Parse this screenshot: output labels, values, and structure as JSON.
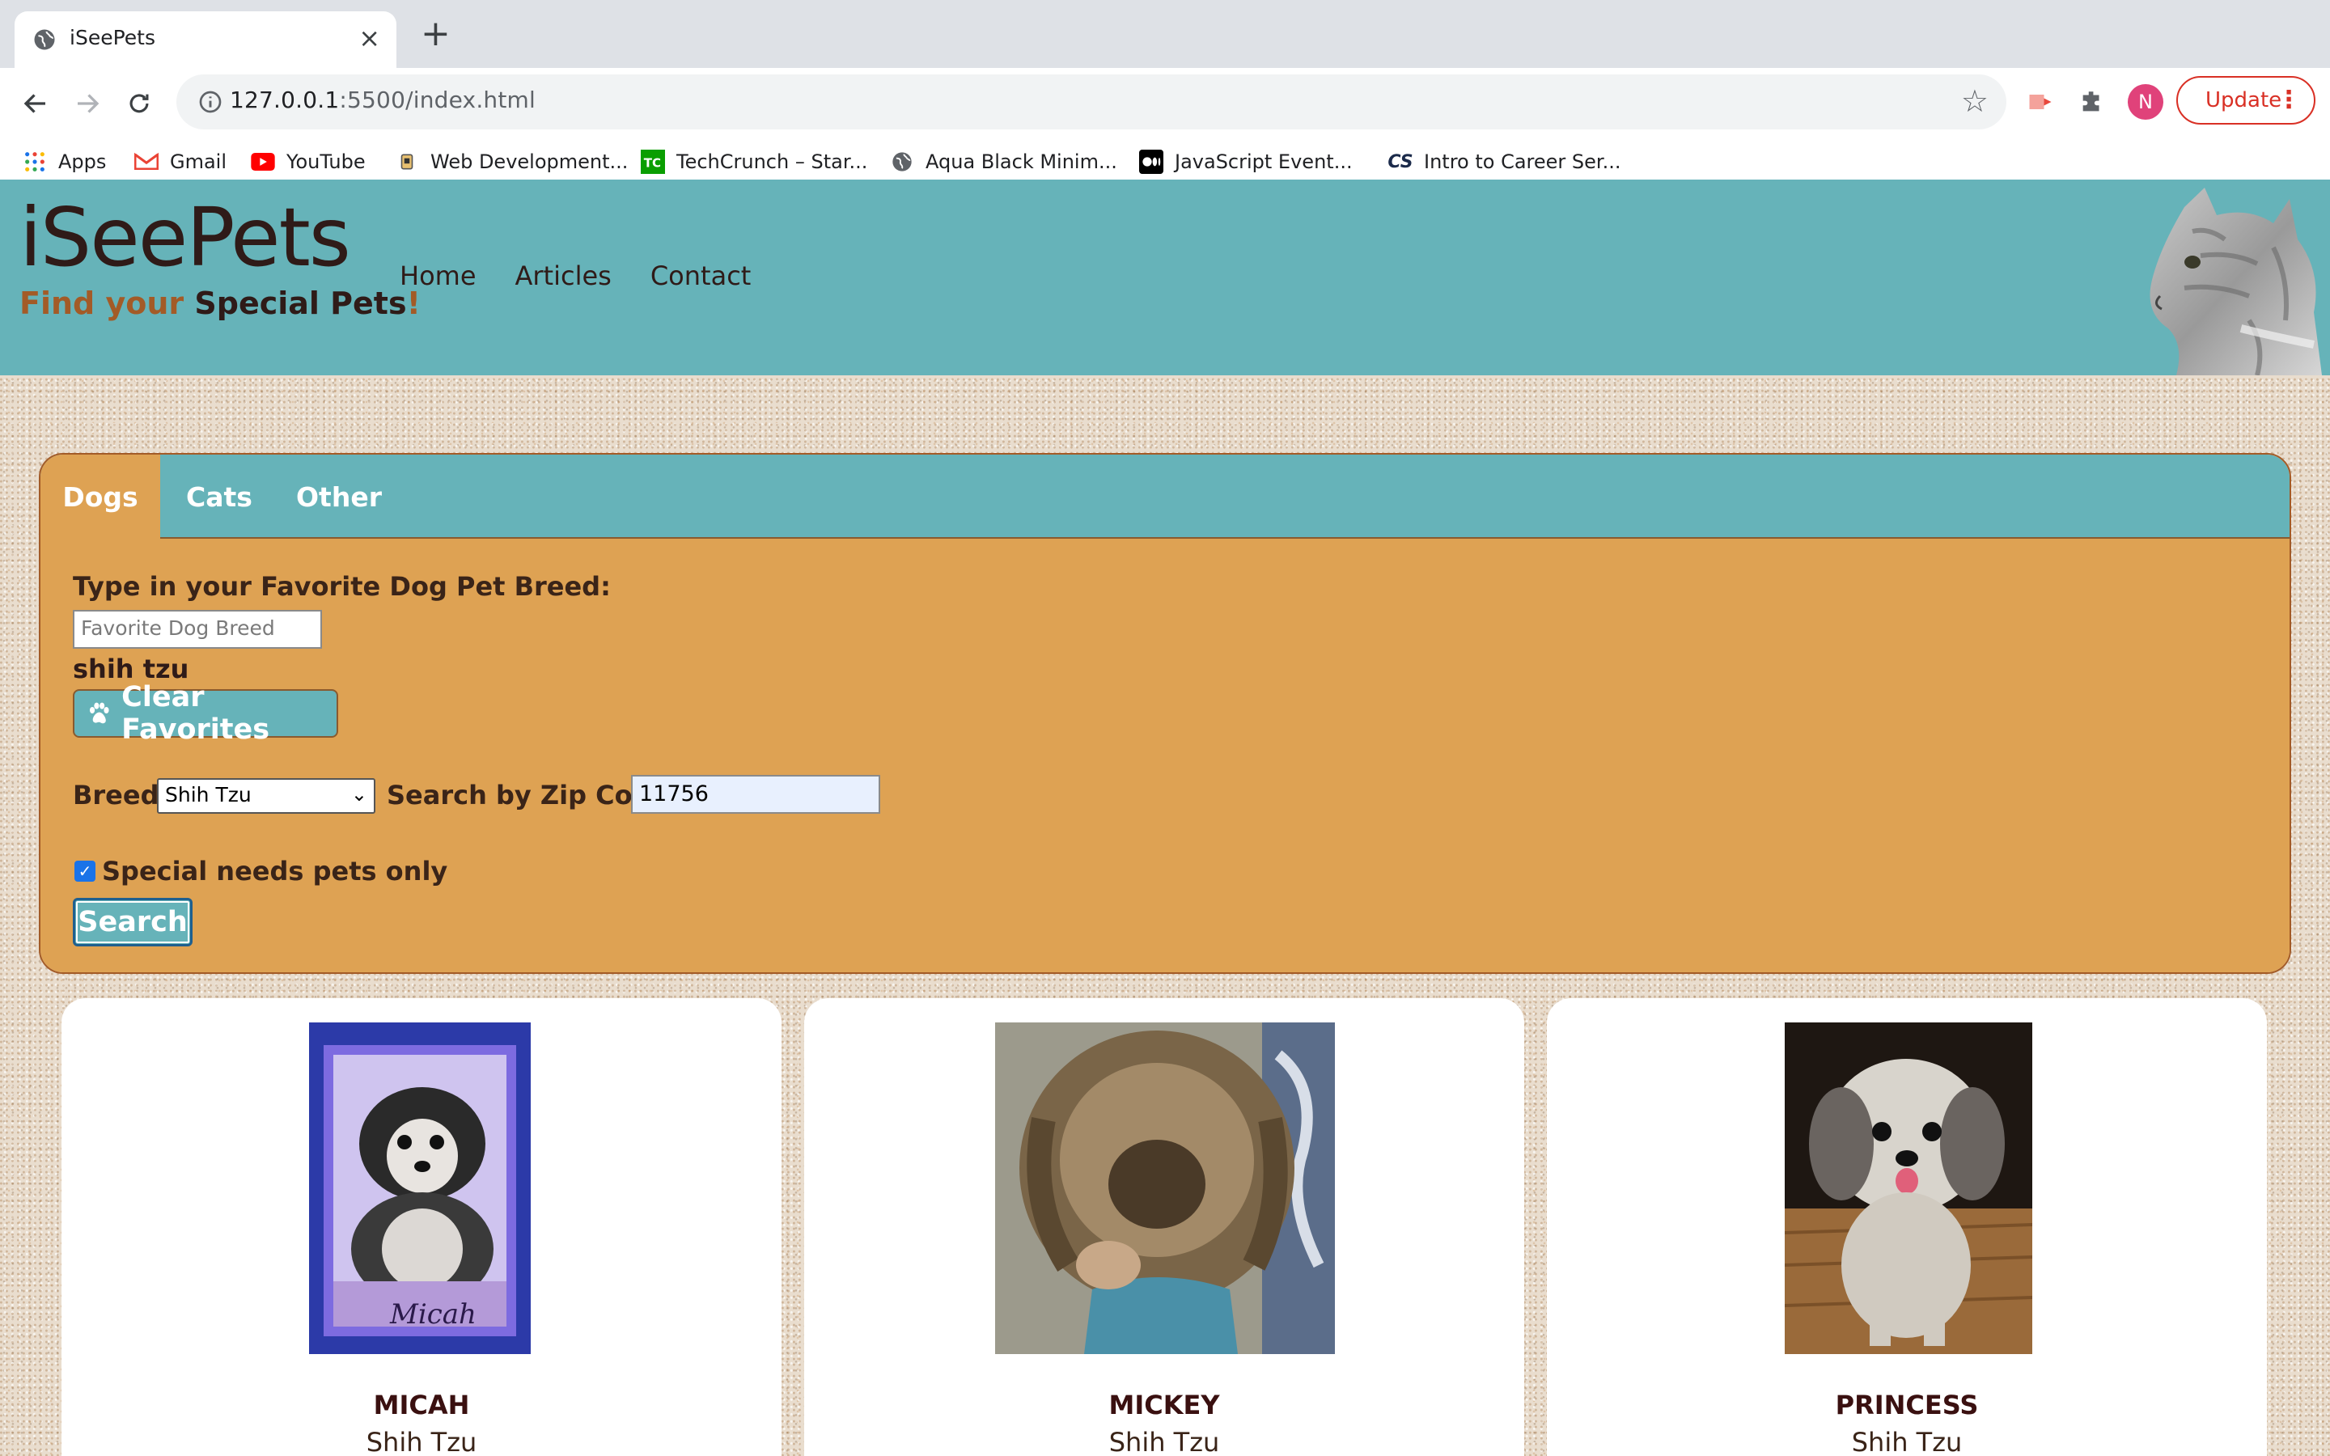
{
  "browser": {
    "tab_title": "iSeePets",
    "tab_close": "×",
    "new_tab": "+",
    "url_host": "127.0.0.1",
    "url_rest": ":5500/index.html",
    "update_label": "Update",
    "avatar_initial": "N",
    "bookmarks": [
      {
        "label": "Apps",
        "icon": "apps-grid-icon"
      },
      {
        "label": "Gmail",
        "icon": "gmail-icon"
      },
      {
        "label": "YouTube",
        "icon": "youtube-icon"
      },
      {
        "label": "Web Development...",
        "icon": "bookmark-favicon-icon"
      },
      {
        "label": "TechCrunch – Star...",
        "icon": "techcrunch-icon"
      },
      {
        "label": "Aqua Black Minim...",
        "icon": "globe-icon"
      },
      {
        "label": "JavaScript Event...",
        "icon": "medium-icon"
      },
      {
        "label": "Intro to Career Ser...",
        "icon": "cs-icon"
      }
    ]
  },
  "site": {
    "logo": "iSeePets",
    "tagline": {
      "part1": "Find your ",
      "part2": "Special Pets",
      "part3": "!"
    },
    "nav": [
      "Home",
      "Articles",
      "Contact"
    ],
    "colors": {
      "header": "#66b3b9",
      "panel": "#dea253",
      "brown": "#a35b27",
      "dark": "#2f1b18"
    }
  },
  "search_panel": {
    "tabs": [
      "Dogs",
      "Cats",
      "Other"
    ],
    "active_tab": "Dogs",
    "fav_label": "Type in your Favorite Dog Pet Breed:",
    "fav_placeholder": "Favorite Dog Breed",
    "fav_value": "shih tzu",
    "clear_label": "Clear Favorites",
    "breed_label": "Breed:",
    "breed_selected": "Shih Tzu",
    "zip_label": "Search by Zip Code:",
    "zip_value": "11756",
    "special_label": "Special needs pets only",
    "special_checked": true,
    "search_label": "Search"
  },
  "pets": [
    {
      "name": "MICAH",
      "breed": "Shih Tzu"
    },
    {
      "name": "MICKEY",
      "breed": "Shih Tzu"
    },
    {
      "name": "PRINCESS",
      "breed": "Shih Tzu"
    }
  ]
}
